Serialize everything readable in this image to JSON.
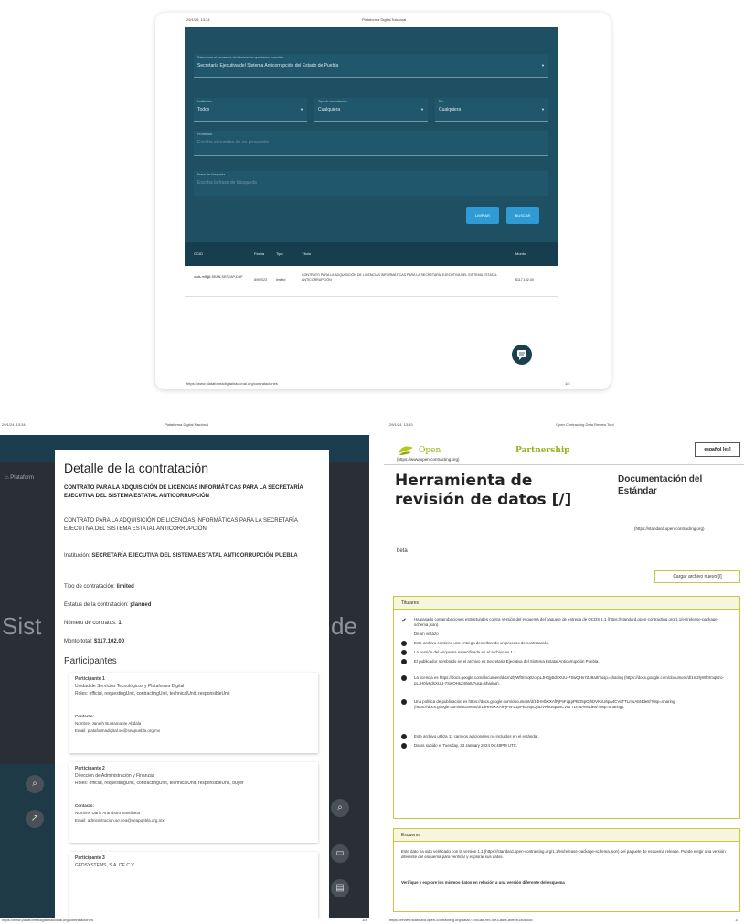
{
  "top": {
    "header_left": "29/1/24, 13:34",
    "header_center": "Plataforma Digital Nacional",
    "source_label": "Seleccione el proveedor de información que desea consultar",
    "source_value": "Secretaría Ejecutiva del Sistema Anticorrupción del Estado de Puebla",
    "institucion_label": "Institución",
    "institucion_value": "Todos",
    "tipo_label": "Tipo de contratación",
    "tipo_value": "Cualquiera",
    "etc_label": "Etc",
    "etc_value": "Cualquiera",
    "proveedor_label": "Proveedor",
    "proveedor_placeholder": "Escriba el nombre de un proveedor",
    "frase_label": "Frase de búsqueda",
    "frase_placeholder": "Escriba la frase de búsqueda",
    "limpiar_label": "LIMPIAR",
    "buscar_label": "BUSCAR",
    "table": {
      "headers": [
        "OCID",
        "Fecha",
        "Tipo",
        "Título",
        "Monto"
      ],
      "rows": [
        {
          "ocid": "ocds-mf6jj6-SEAN-SESEAP-DAP",
          "fecha": "8/9/2023",
          "tipo": "limited",
          "titulo": "CONTRATO PARA LA ADQUISICIÓN DE LICENCIAS INFORMÁTICAS PARA LA SECRETARÍA EJECUTIVA DEL SISTEMA ESTATAL ANTICORRUPCIÓN",
          "monto": "$117,102.00"
        }
      ]
    },
    "footer_url": "https://www.plataformadigitalnacional.org/contrataciones",
    "footer_page": "1/4"
  },
  "left": {
    "header_left": "29/1/24, 13:34",
    "header_center": "Plataforma Digital Nacional",
    "title": "Detalle de la contratación",
    "bold_title": "CONTRATO PARA LA ADQUISICIÓN DE LICENCIAS INFORMÁTICAS PARA LA SECRETARÍA EJECUTIVA DEL SISTEMA ESTATAL ANTICORRUPCIÓN",
    "desc": "CONTRATO PARA LA ADQUISICIÓN DE LICENCIAS INFORMÁTICAS PARA LA SECRETARÍA EJECUTIVA DEL SISTEMA ESTATAL ANTICORRUPCIÓN",
    "institucion_label": "Institución: ",
    "institucion_value": "SECRETARÍA EJECUTIVA DEL SISTEMA ESTATAL ANTICORRUPCIÓN PUEBLA",
    "tipo_label": "Tipo de contratación: ",
    "tipo_value": "limited",
    "estatus_label": "Estatus de la contratacion: ",
    "estatus_value": "planned",
    "numero_label": "Número de contratos: ",
    "numero_value": "1",
    "monto_label": "Monto total: ",
    "monto_value": "$117,102.00",
    "participants_heading": "Participantes",
    "participants": [
      {
        "title": "Participante 1",
        "name": "Unidad de Servicios Tecnológicos y Plataforma Digital",
        "roles": "Roles: official, requestingUnit, contractingUnit, technicalUnit, responsibleUnit",
        "contact_label": "Contacto:",
        "contact_name": "Nombre: Janeth Bustamante Abdala",
        "contact_email": "Email: plataformadigital.se@seapuebla.org.mx"
      },
      {
        "title": "Participante 2",
        "name": "Dirección de Administración y Finanzas",
        "roles": "Roles: official, requestingUnit, contractingUnit, technicalUnit, responsibleUnit, buyer",
        "contact_label": "Contacto:",
        "contact_name": "Nombre: Dario Aramburu Santillana",
        "contact_email": "Email: administracion.se.sea@seapuebla.org.mx"
      },
      {
        "title": "Participante 3",
        "name": "GFDSYSTEMS, S.A. DE C.V."
      }
    ],
    "bg_text_left": "Sist",
    "bg_text_right": "de",
    "bg_link": "Plataform",
    "footer_url": "https://www.plataformadigitalnacional.org/contrataciones",
    "footer_page": "1/4"
  },
  "right": {
    "header_left": "29/1/24, 13:33",
    "header_center": "Open Contracting Data Review Tool",
    "logo_open": "Open",
    "logo_partnership": "Partnership",
    "logo_url": "(https://www.open-contracting.org)",
    "lang_button": "español [es]",
    "title": "Herramienta de revisión de datos [/]",
    "doc_title": "Documentación del Estándar",
    "doc_url": "(https://standard.open-contracting.org)",
    "beta": "beta",
    "load_button": "Cargar archivo nuevo [/]",
    "titulares_heading": "Titulares",
    "check_text": "Ha pasado comprobaciones estructurales contra Versión del esquema del paquete de entrega de OCDS 1.1 (https://standard.open-contracting.org/1.1/es/release-package-schema.json).",
    "de_un_vistazo": "De un vistazo",
    "bullets": [
      "Este archivo contiene una entrega describiendo un proceso de contratación.",
      "La versión del esquema especificada en el archivo es 1.1.",
      "El publicador nombrado en el archivo es Secretaria Ejecutiva del Sistema Estatal Anticorrupción Puebla.",
      "La licencia es https://docs.google.com/document/d/1m2lyWf0rmq0zo-pLJH0jy8dsXUU-7SwQHs7Z49aIt/?usp=sharing (https://docs.google.com/document/d/1m2lyWf0rmq0zo-pLJH0jy8dsXUU-7SwQHsZ49aIt/?usp=sharing).",
      "Una política de publicación es https://docs.google.com/document/d/1dHHbXXAfPjPvFq1pPBO5pOjhDVKkU6pa4CVoTTLmuAM4de8/?usp=sharing (https://docs.google.com/document/d/1dHHbXXAfPjPvFq1pPBO5pOjhDVKkU6pa4CVoTTLmuAM4de8/?usp=sharing).",
      "Este archivo utiliza 11 campos adicionales no incluidos en el estándar.",
      "Datos subido el Tuesday, 23 January 2024 06:48PM UTC."
    ],
    "esquema_heading": "Esquema",
    "esquema_text": "Este dato ha sido verificado con la versión 1.1 (https://standard.open-contracting.org/1.1/es/release-package-schema.json) del paquete de esquema release. Puede elegir una versión diferente del esquema para verificar y explorar sus datos.",
    "esquema_bold": "Verifique y explore los mismos datos en relación a una versión diferente del esquema",
    "footer_url": "https://review.standard.open-contracting.org/data/77981a8-9f9-4fe3-a66f-a9eeb1466058",
    "footer_page": "1/"
  }
}
